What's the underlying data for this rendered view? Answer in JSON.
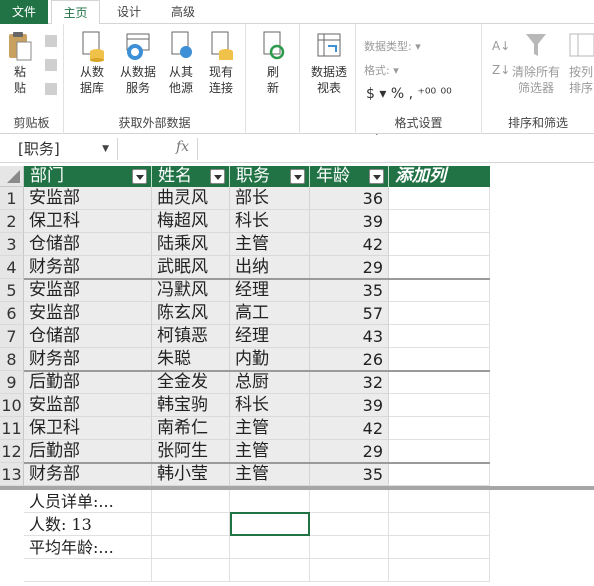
{
  "tabs": [
    {
      "label": "文件"
    },
    {
      "label": "主页"
    },
    {
      "label": "设计"
    },
    {
      "label": "高级"
    }
  ],
  "ribbon": {
    "clipboard": {
      "paste": "粘\n贴",
      "group_label": "剪贴板"
    },
    "external": {
      "from_db": "从数\n据库",
      "from_service": "从数据\n服务",
      "from_other": "从其\n他源",
      "existing": "现有\n连接",
      "group_label": "获取外部数据"
    },
    "refresh": {
      "label": "刷\n新"
    },
    "pivot": {
      "label": "数据透\n视表"
    },
    "format": {
      "data_type": "数据类型:",
      "format": "格式:",
      "symbols": "$ ▾ %  ,  ⁺⁰⁰  ⁰⁰",
      "group_label": "格式设置"
    },
    "sort": {
      "clear": "清除所有\n筛选器",
      "sort_by": "按列\n排序",
      "group_label": "排序和筛选"
    }
  },
  "formula_bar": {
    "name_box": "[职务]",
    "fx": "fx",
    "value": ""
  },
  "table": {
    "columns": [
      "部门",
      "姓名",
      "职务",
      "年龄"
    ],
    "add_column": "添加列",
    "rows": [
      {
        "n": "1",
        "dept": "安监部",
        "name": "曲灵风",
        "title": "部长",
        "age": "36"
      },
      {
        "n": "2",
        "dept": "保卫科",
        "name": "梅超风",
        "title": "科长",
        "age": "39"
      },
      {
        "n": "3",
        "dept": "仓储部",
        "name": "陆乘风",
        "title": "主管",
        "age": "42"
      },
      {
        "n": "4",
        "dept": "财务部",
        "name": "武眠风",
        "title": "出纳",
        "age": "29"
      },
      {
        "n": "5",
        "dept": "安监部",
        "name": "冯默风",
        "title": "经理",
        "age": "35"
      },
      {
        "n": "6",
        "dept": "安监部",
        "name": "陈玄风",
        "title": "高工",
        "age": "57"
      },
      {
        "n": "7",
        "dept": "仓储部",
        "name": "柯镇恶",
        "title": "经理",
        "age": "43"
      },
      {
        "n": "8",
        "dept": "财务部",
        "name": "朱聪",
        "title": "内勤",
        "age": "26"
      },
      {
        "n": "9",
        "dept": "后勤部",
        "name": "全金发",
        "title": "总厨",
        "age": "32"
      },
      {
        "n": "10",
        "dept": "安监部",
        "name": "韩宝驹",
        "title": "科长",
        "age": "39"
      },
      {
        "n": "11",
        "dept": "保卫科",
        "name": "南希仁",
        "title": "主管",
        "age": "42"
      },
      {
        "n": "12",
        "dept": "后勤部",
        "name": "张阿生",
        "title": "主管",
        "age": "29"
      },
      {
        "n": "13",
        "dept": "财务部",
        "name": "韩小莹",
        "title": "主管",
        "age": "35"
      }
    ]
  },
  "calc_area": {
    "detail": "人员详单:...",
    "count": "人数: 13",
    "avg_age": "平均年龄:..."
  },
  "colors": {
    "accent": "#217346"
  }
}
